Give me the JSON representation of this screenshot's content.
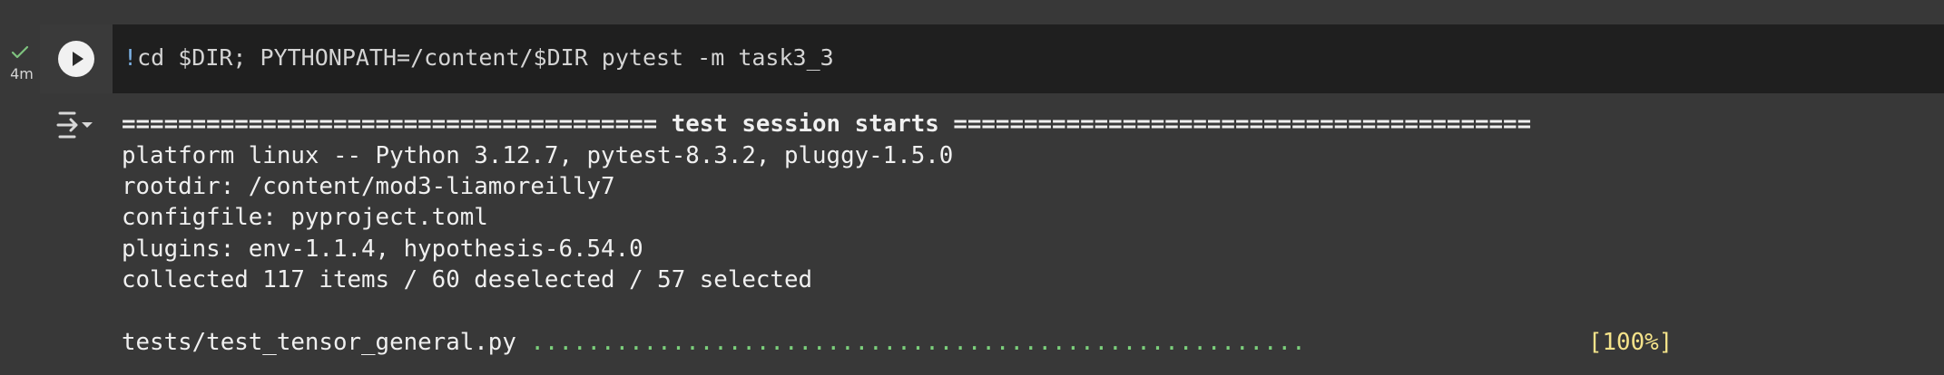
{
  "cell": {
    "status": "success",
    "exec_time": "4m",
    "code_prefix": "!",
    "code_rest": "cd $DIR; PYTHONPATH=/content/$DIR pytest -m task3_3"
  },
  "output": {
    "session_rule_left": "======================================",
    "session_title": " test session starts ",
    "session_rule_right": "=========================================",
    "lines": [
      "platform linux -- Python 3.12.7, pytest-8.3.2, pluggy-1.5.0",
      "rootdir: /content/mod3-liamoreilly7",
      "configfile: pyproject.toml",
      "plugins: env-1.1.4, hypothesis-6.54.0",
      "collected 117 items / 60 deselected / 57 selected"
    ],
    "test_file": "tests/test_tensor_general.py ",
    "test_dots": ".......................................................",
    "test_pct": "[100%]"
  },
  "icons": {
    "status": "check-icon",
    "run": "play-icon",
    "output_toggle": "output-toggle-icon"
  },
  "colors": {
    "success": "#7ec27e",
    "dots": "#7cd07c",
    "percent": "#f5e38a"
  }
}
